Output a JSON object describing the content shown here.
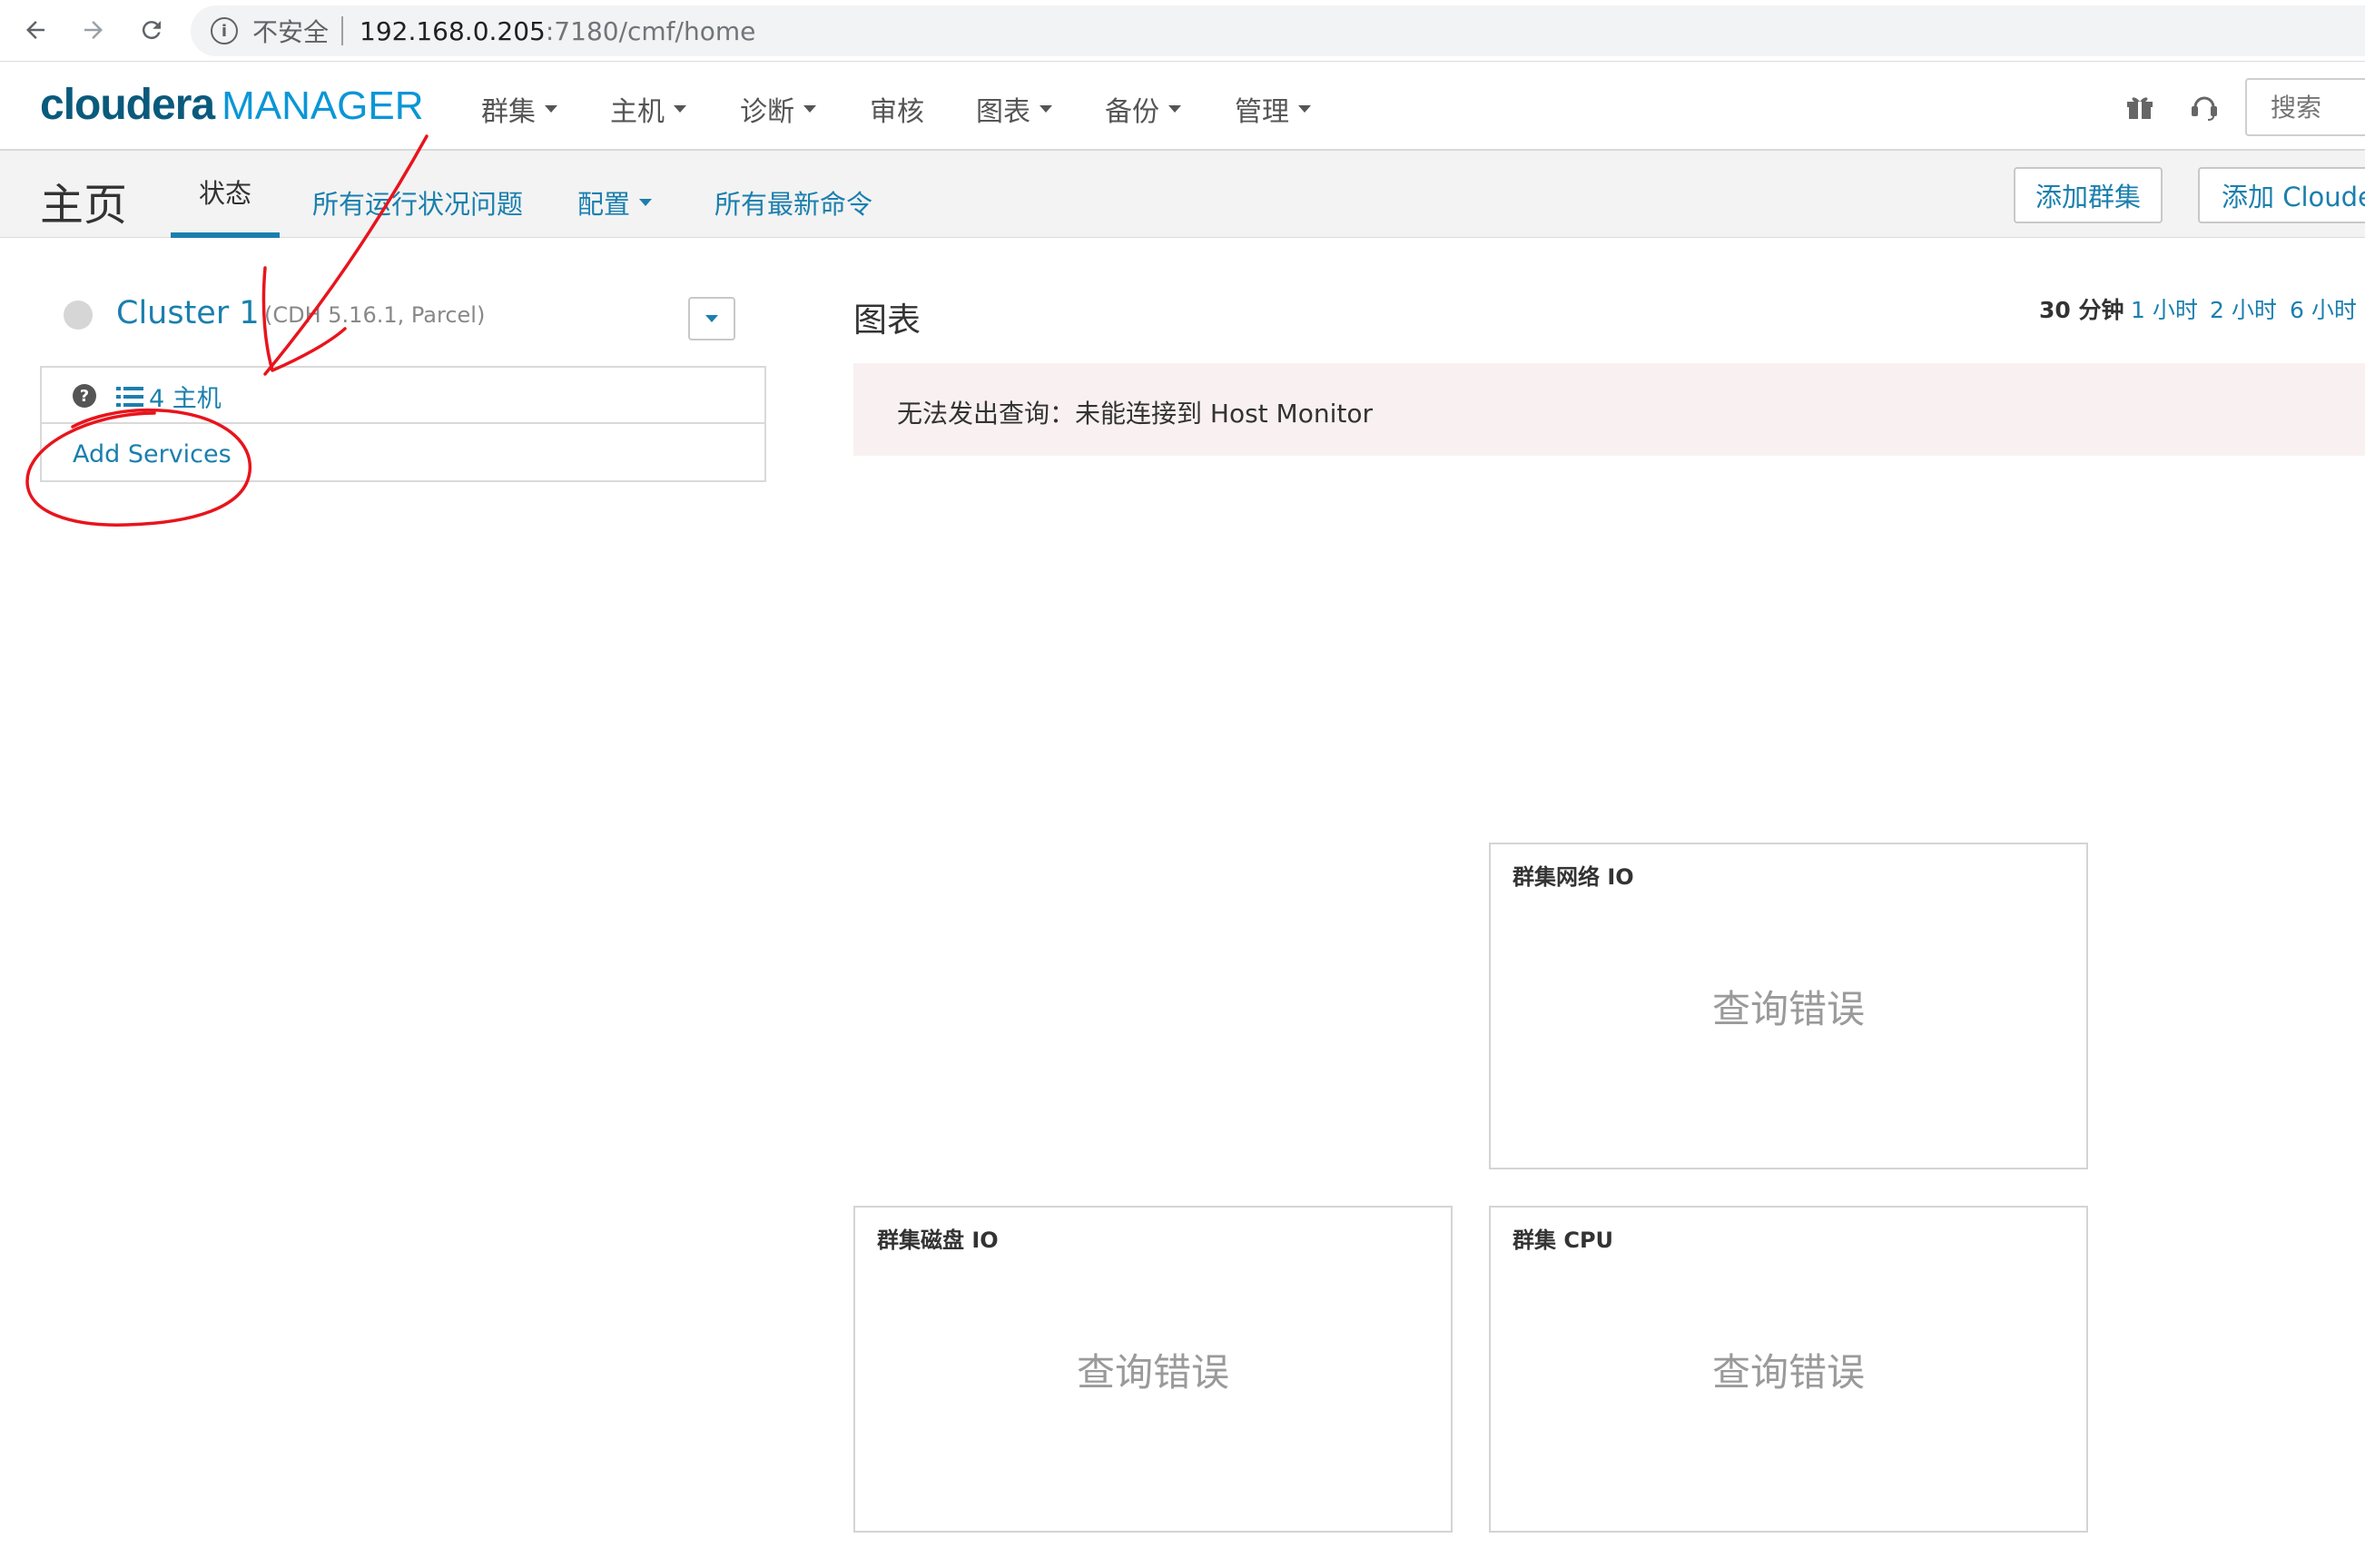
{
  "browser": {
    "security_label": "不安全",
    "url_host": "192.168.0.205",
    "url_path": ":7180/cmf/home"
  },
  "topnav": {
    "logo_brand": "cloudera",
    "logo_product": "MANAGER",
    "menus": [
      "群集",
      "主机",
      "诊断",
      "审核",
      "图表",
      "备份",
      "管理"
    ],
    "search_placeholder": "搜索"
  },
  "subheader": {
    "title": "主页",
    "tabs": [
      "状态",
      "所有运行状况问题",
      "配置",
      "所有最新命令"
    ],
    "add_cluster_button": "添加群集",
    "add_cloudera_button": "添加 Clouder"
  },
  "cluster": {
    "name": "Cluster 1",
    "version": "(CDH 5.16.1, Parcel)",
    "hosts_link": "4 主机",
    "add_services": "Add Services"
  },
  "charts": {
    "title": "图表",
    "ranges": [
      "30 分钟",
      "1 小时",
      "2 小时",
      "6 小时"
    ],
    "error_message": "无法发出查询：未能连接到 Host Monitor",
    "cards": [
      {
        "title": "群集网络 IO",
        "status": "查询错误"
      },
      {
        "title": "群集磁盘 IO",
        "status": "查询错误"
      },
      {
        "title": "群集 CPU",
        "status": "查询错误"
      }
    ]
  },
  "colors": {
    "link": "#1a7fae",
    "logo_dark": "#0a5a7c",
    "logo_light": "#0a96d6",
    "annotation": "#e8141c",
    "alert_bg": "#f9f1f1"
  }
}
